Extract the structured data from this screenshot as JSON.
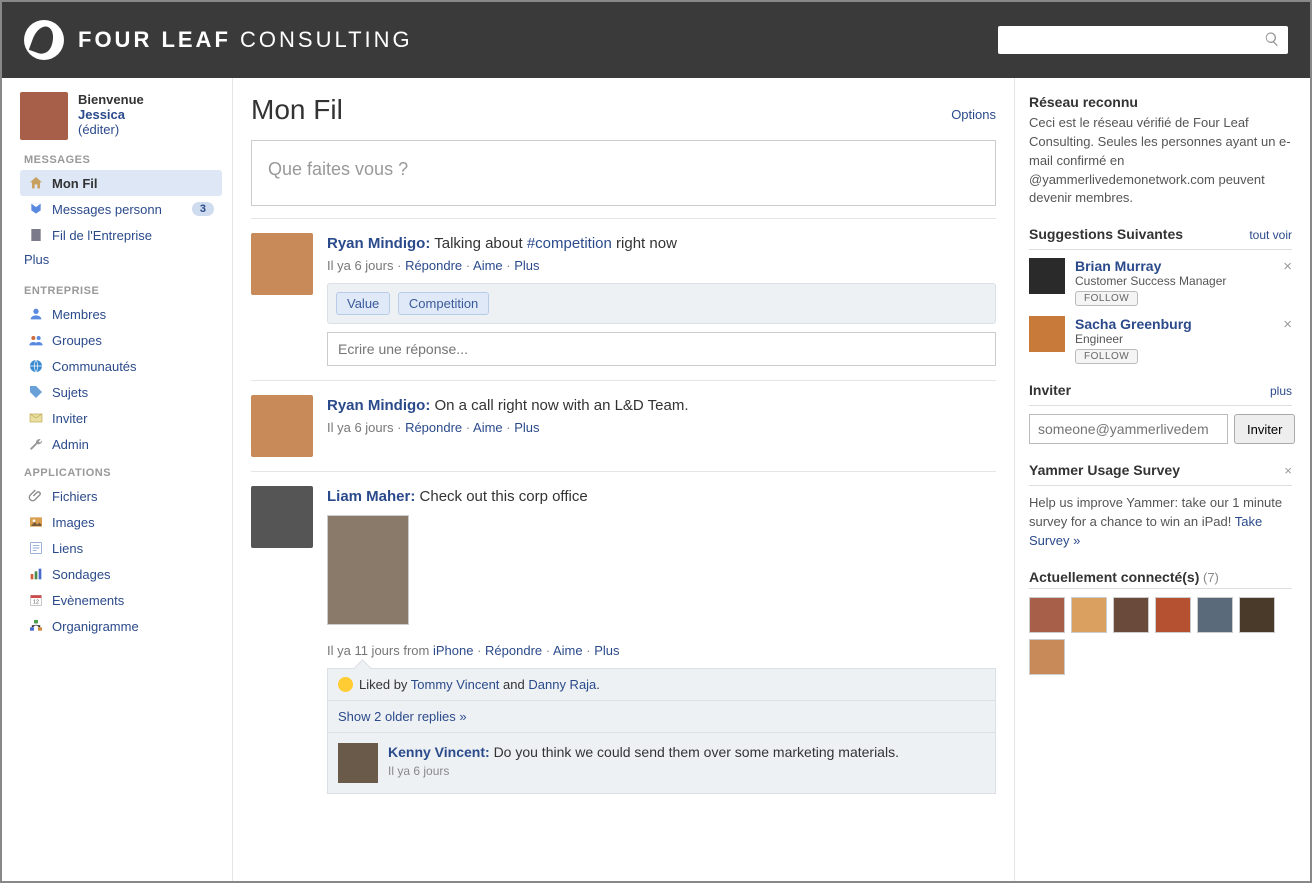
{
  "brand": {
    "name_strong": "FOUR LEAF",
    "name_light": "CONSULTING"
  },
  "search": {
    "placeholder": ""
  },
  "user": {
    "welcome": "Bienvenue",
    "name": "Jessica",
    "edit": "(éditer)"
  },
  "sidebar": {
    "section_messages": "MESSAGES",
    "items_messages": [
      {
        "label": "Mon Fil",
        "icon": "home-icon",
        "active": true
      },
      {
        "label": "Messages personn",
        "icon": "inbox-icon",
        "badge": "3"
      },
      {
        "label": "Fil de l'Entreprise",
        "icon": "building-icon"
      }
    ],
    "plus": "Plus",
    "section_entreprise": "ENTREPRISE",
    "items_entreprise": [
      {
        "label": "Membres",
        "icon": "person-icon"
      },
      {
        "label": "Groupes",
        "icon": "people-icon"
      },
      {
        "label": "Communautés",
        "icon": "globe-icon"
      },
      {
        "label": "Sujets",
        "icon": "tag-icon"
      },
      {
        "label": "Inviter",
        "icon": "mail-icon"
      },
      {
        "label": "Admin",
        "icon": "wrench-icon"
      }
    ],
    "section_applications": "APPLICATIONS",
    "items_applications": [
      {
        "label": "Fichiers",
        "icon": "clip-icon"
      },
      {
        "label": "Images",
        "icon": "image-icon"
      },
      {
        "label": "Liens",
        "icon": "link-icon"
      },
      {
        "label": "Sondages",
        "icon": "chart-icon"
      },
      {
        "label": "Evènements",
        "icon": "calendar-icon"
      },
      {
        "label": "Organigramme",
        "icon": "org-icon"
      }
    ]
  },
  "feed": {
    "title": "Mon Fil",
    "options": "Options",
    "composer_placeholder": "Que faites vous ?",
    "reply_placeholder": "Ecrire une réponse...",
    "meta": {
      "reply": "Répondre",
      "like": "Aime",
      "more": "Plus"
    },
    "posts": [
      {
        "author": "Ryan Mindigo",
        "text_before": "Talking about ",
        "hashtag": "#competition",
        "text_after": " right now",
        "time": "Il ya 6 jours",
        "tags": [
          "Value",
          "Competition"
        ]
      },
      {
        "author": "Ryan Mindigo",
        "text": "On a call right now with an L&D Team.",
        "time": "Il ya 6 jours"
      },
      {
        "author": "Liam Maher",
        "text": "Check out this corp office",
        "time_prefix": "Il ya 11 jours from ",
        "time_source": "iPhone",
        "liked_prefix": "Liked by ",
        "liked_1": "Tommy Vincent",
        "liked_and": " and ",
        "liked_2": "Danny  Raja",
        "older": "Show 2 older replies »",
        "reply_author": "Kenny Vincent",
        "reply_text": "Do you think we could send them over some marketing materials.",
        "reply_time": "Il ya 6 jours"
      }
    ]
  },
  "right": {
    "verified_title": "Réseau reconnu",
    "verified_text": "Ceci est le réseau vérifié de Four Leaf Consulting. Seules les personnes ayant un e-mail confirmé en @yammerlivedemonetwork.com peuvent devenir membres.",
    "suggestions_title": "Suggestions Suivantes",
    "see_all": "tout voir",
    "suggestions": [
      {
        "name": "Brian Murray",
        "role": "Customer Success Manager"
      },
      {
        "name": "Sacha Greenburg",
        "role": "Engineer"
      }
    ],
    "follow": "FOLLOW",
    "invite_title": "Inviter",
    "invite_more": "plus",
    "invite_placeholder": "someone@yammerlivedem",
    "invite_button": "Inviter",
    "survey_title": "Yammer Usage Survey",
    "survey_text": "Help us improve Yammer: take our 1 minute survey for a chance to win an iPad! ",
    "survey_link": "Take Survey »",
    "online_title": "Actuellement connecté(s)",
    "online_count": "(7)"
  },
  "avatar_colors": {
    "user": "#a85f4a",
    "ryan": "#c98a5a",
    "liam": "#555555",
    "kenny": "#7a5a4a",
    "brian": "#2a2a2a",
    "sacha": "#c87a3a",
    "online": [
      "#a85f4a",
      "#d9a060",
      "#6a4a3a",
      "#b55030",
      "#5a6a7a",
      "#4a3a2a",
      "#c98a5a"
    ]
  }
}
